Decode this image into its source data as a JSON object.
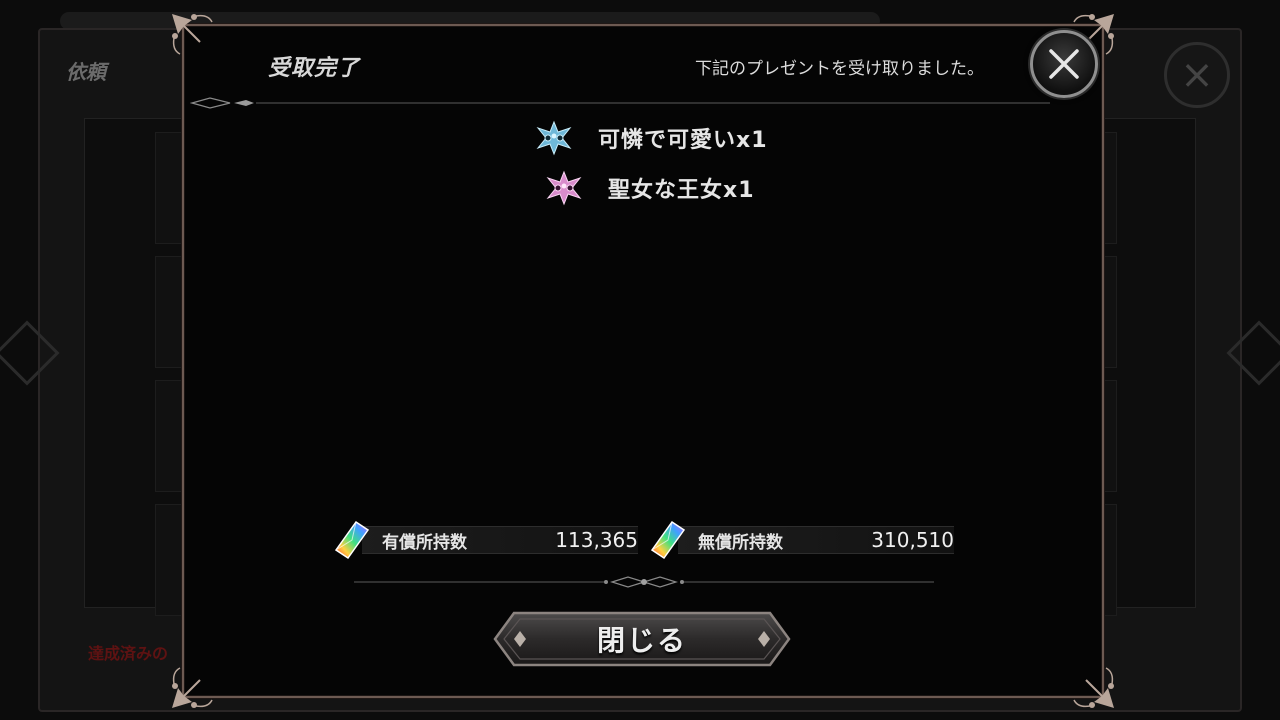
{
  "background": {
    "screen_title": "依頼",
    "footer_notice": "達成済みの"
  },
  "dialog": {
    "title": "受取完了",
    "subtitle": "下記のプレゼントを受け取りました。",
    "items": [
      {
        "label": "可憐で可愛いx1",
        "icon": "blue-crest-icon",
        "color": "#9fd8ee"
      },
      {
        "label": "聖女な王女x1",
        "icon": "pink-crest-icon",
        "color": "#f0b6e6"
      }
    ],
    "currency": {
      "paid_label": "有償所持数",
      "paid_value": "113,365",
      "free_label": "無償所持数",
      "free_value": "310,510"
    },
    "close_button_label": "閉じる"
  },
  "colors": {
    "frame": "#6d5a52",
    "ornament": "#b9a69a",
    "background": "#050505"
  }
}
